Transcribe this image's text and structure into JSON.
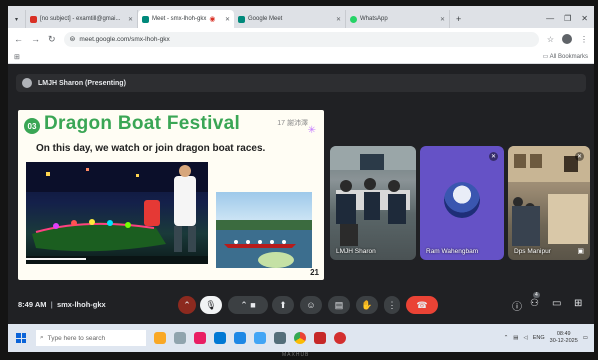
{
  "browser": {
    "tabs": [
      {
        "label": "[no subject] - examtill@gmai...",
        "favicon_color": "#d93025"
      },
      {
        "label": "Meet - smx-lhoh-gkx",
        "favicon_color": "#00897b",
        "active": true
      },
      {
        "label": "Google Meet",
        "favicon_color": "#00897b"
      },
      {
        "label": "WhatsApp",
        "favicon_color": "#25d366"
      }
    ],
    "url": "meet.google.com/smx-lhoh-gkx",
    "all_bookmarks": "All Bookmarks"
  },
  "meet": {
    "presenter_label": "LMJH Sharon (Presenting)",
    "meeting_time": "8:49 AM",
    "meeting_code": "smx-lhoh-gkx",
    "participants": [
      {
        "name": "LMJH Sharon"
      },
      {
        "name": "Ram Wahengbam"
      },
      {
        "name": "Dps Manipur"
      }
    ],
    "participant_badge": "4"
  },
  "slide": {
    "number": "03",
    "title": "Dragon Boat Festival",
    "chinese": "17 謝沛澤",
    "subtitle": "On this day, we watch or join dragon boat races.",
    "page": "21"
  },
  "taskbar": {
    "search_placeholder": "Type here to search",
    "lang": "ENG",
    "time": "08:49",
    "date": "30-12-2025"
  },
  "monitor_brand": "MAXHUB"
}
